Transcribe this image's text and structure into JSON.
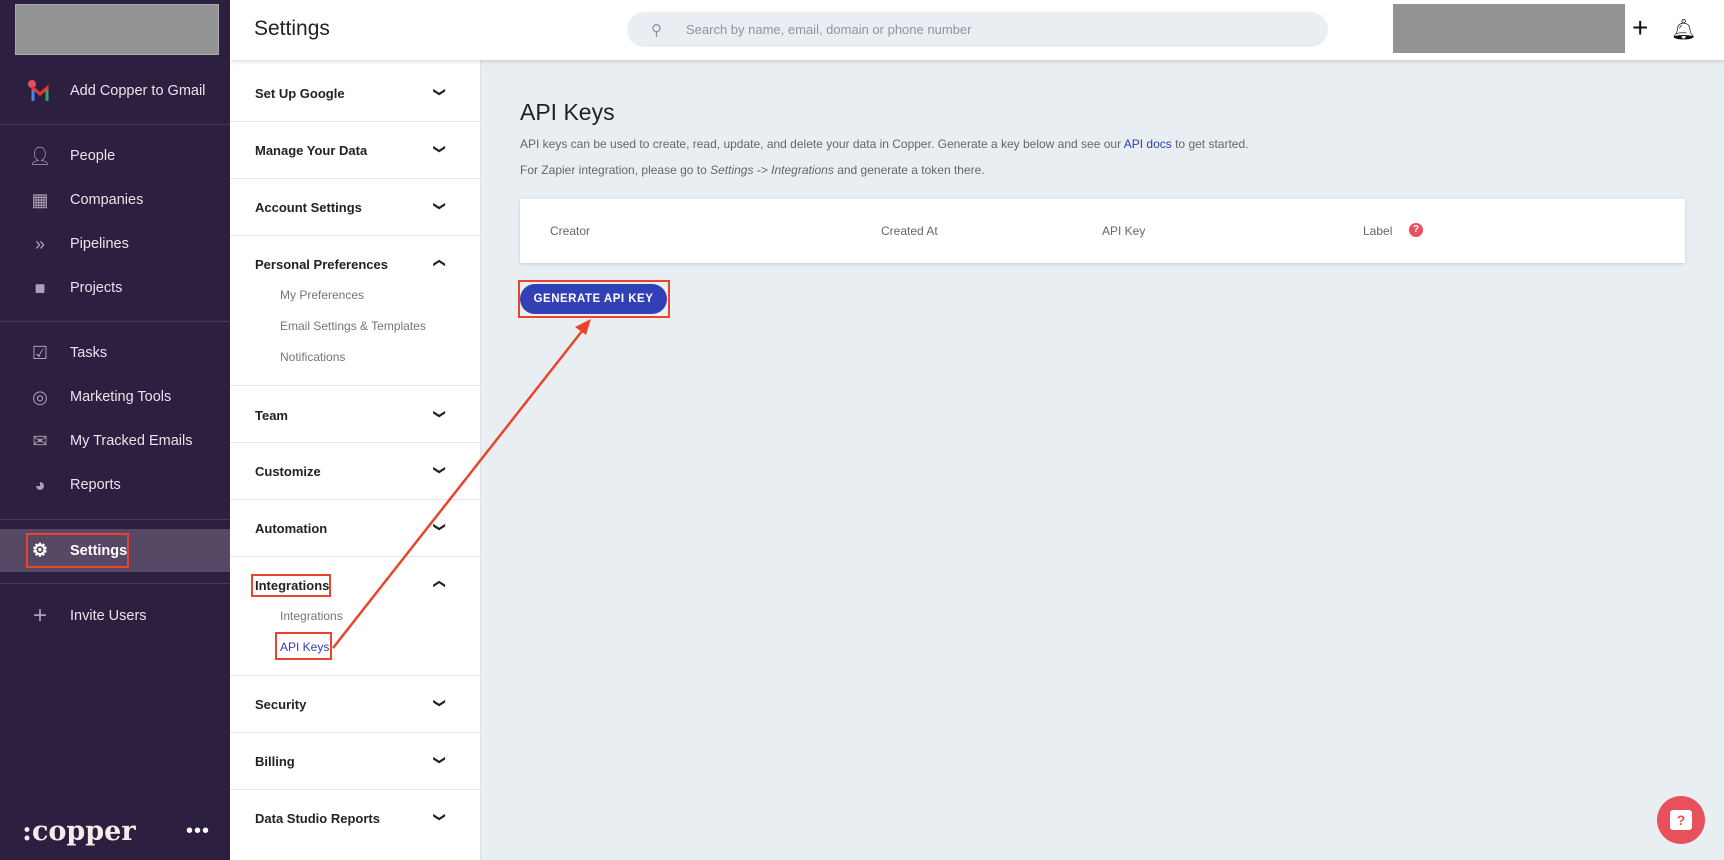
{
  "sidebar": {
    "gmail": "Add Copper to Gmail",
    "items": [
      {
        "label": "People",
        "icon": "person-icon"
      },
      {
        "label": "Companies",
        "icon": "building-icon"
      },
      {
        "label": "Pipelines",
        "icon": "chevrons-icon"
      },
      {
        "label": "Projects",
        "icon": "briefcase-icon"
      },
      {
        "label": "Tasks",
        "icon": "checkbox-icon"
      },
      {
        "label": "Marketing Tools",
        "icon": "play-circle-icon"
      },
      {
        "label": "My Tracked Emails",
        "icon": "mail-icon"
      },
      {
        "label": "Reports",
        "icon": "pie-chart-icon"
      },
      {
        "label": "Settings",
        "icon": "gear-icon"
      },
      {
        "label": "Invite Users",
        "icon": "plus-icon"
      }
    ],
    "logo": ":copper"
  },
  "header": {
    "title": "Settings",
    "search_placeholder": "Search by name, email, domain or phone number"
  },
  "settings_nav": {
    "sections": [
      {
        "label": "Set Up Google"
      },
      {
        "label": "Manage Your Data"
      },
      {
        "label": "Account Settings"
      },
      {
        "label": "Personal Preferences",
        "items": [
          "My Preferences",
          "Email Settings & Templates",
          "Notifications"
        ]
      },
      {
        "label": "Team"
      },
      {
        "label": "Customize"
      },
      {
        "label": "Automation"
      },
      {
        "label": "Integrations",
        "items": [
          "Integrations",
          "API Keys"
        ]
      },
      {
        "label": "Security"
      },
      {
        "label": "Billing"
      },
      {
        "label": "Data Studio Reports"
      }
    ]
  },
  "main": {
    "title": "API Keys",
    "desc1_a": "API keys can be used to create, read, update, and delete your data in Copper. Generate a key below and see our ",
    "desc1_link": "API docs",
    "desc1_b": " to get started.",
    "desc2_a": "For Zapier integration, please go to ",
    "desc2_em": "Settings -> Integrations",
    "desc2_b": " and generate a token there.",
    "columns": [
      "Creator",
      "Created At",
      "API Key",
      "Label"
    ],
    "button": "GENERATE API KEY"
  },
  "colors": {
    "sidebar": "#2d1f3f",
    "accent": "#3140b5",
    "annotation": "#e8452b",
    "help": "#e8505b"
  }
}
